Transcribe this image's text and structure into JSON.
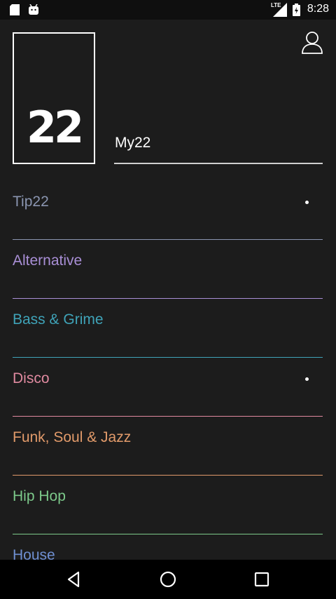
{
  "status_bar": {
    "time": "8:28",
    "network": "LTE",
    "icons": [
      "sd-card-icon",
      "android-icon",
      "lte-signal-icon",
      "battery-icon"
    ]
  },
  "header": {
    "logo_text": "22",
    "profile_icon": "person-icon",
    "my22_label": "My22"
  },
  "genres": [
    {
      "label": "Tip22",
      "color": "#8a95b0",
      "has_dot": true
    },
    {
      "label": "Alternative",
      "color": "#a98fd6",
      "has_dot": false
    },
    {
      "label": "Bass & Grime",
      "color": "#3fa3b8",
      "has_dot": false
    },
    {
      "label": "Disco",
      "color": "#e08aa0",
      "has_dot": true
    },
    {
      "label": "Funk, Soul & Jazz",
      "color": "#e19a6a",
      "has_dot": false
    },
    {
      "label": "Hip Hop",
      "color": "#7cc98a",
      "has_dot": false
    },
    {
      "label": "House",
      "color": "#6f8fd1",
      "has_dot": false
    }
  ],
  "nav_bar": {
    "back_icon": "back-triangle-icon",
    "home_icon": "home-circle-icon",
    "recents_icon": "recents-square-icon"
  }
}
